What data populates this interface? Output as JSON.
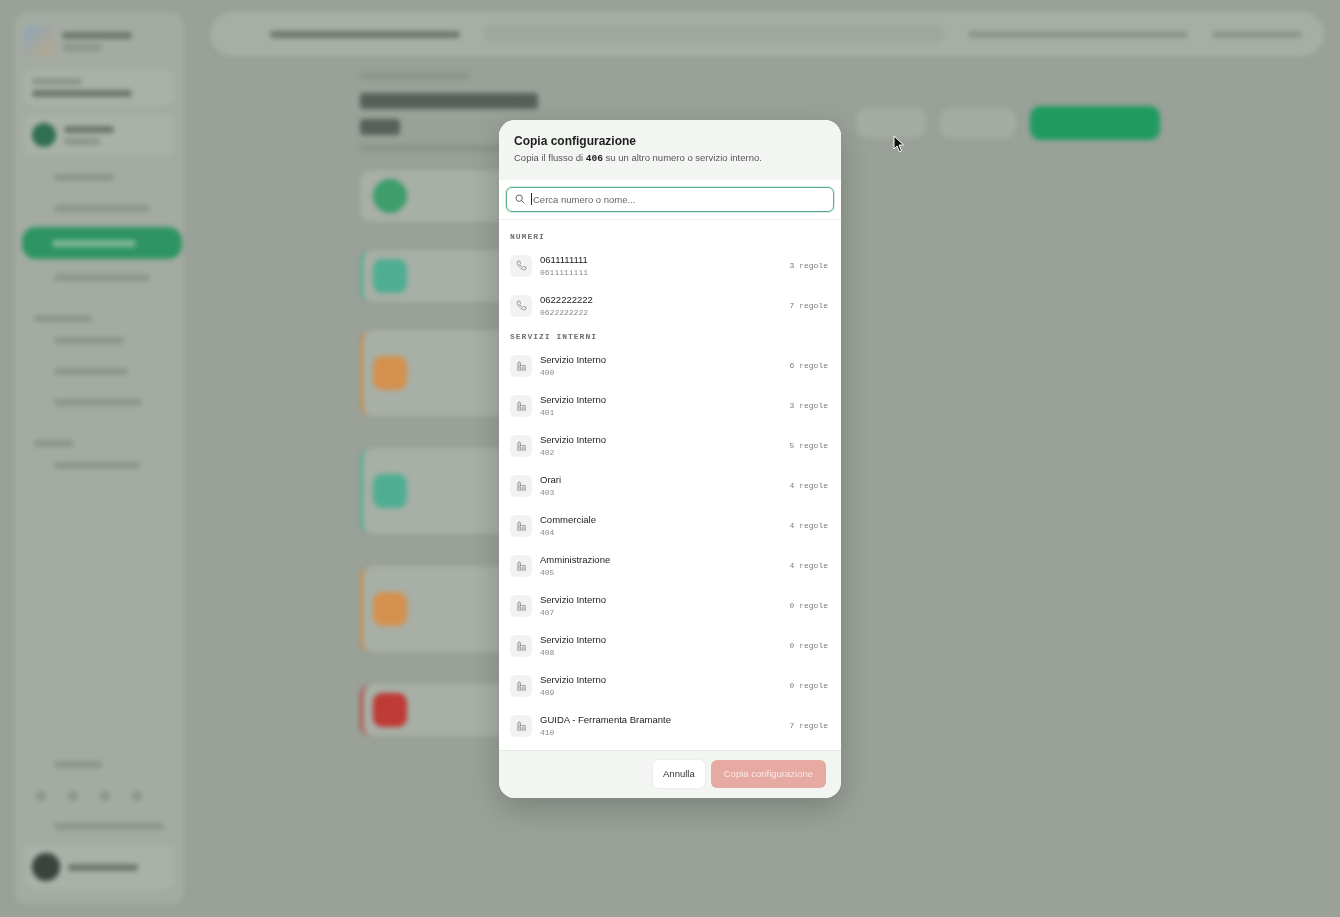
{
  "dialog": {
    "title": "Copia configurazione",
    "subtitle": "Copia il flusso di **406** su un altro numero o servizio interno.",
    "search": {
      "placeholder": "Cerca numero o nome...",
      "focused": true
    },
    "sections": [
      {
        "label": "NUMERI",
        "items": [
          {
            "kind": "phone",
            "name": "0611111111",
            "number": "0611111111",
            "rules": "3 regole"
          },
          {
            "kind": "phone",
            "name": "0622222222",
            "number": "0622222222",
            "rules": "7 regole"
          }
        ]
      },
      {
        "label": "SERVIZI INTERNI",
        "items": [
          {
            "kind": "internal",
            "name": "Servizio Interno",
            "number": "400",
            "rules": "6 regole"
          },
          {
            "kind": "internal",
            "name": "Servizio Interno",
            "number": "401",
            "rules": "3 regole"
          },
          {
            "kind": "internal",
            "name": "Servizio Interno",
            "number": "402",
            "rules": "5 regole"
          },
          {
            "kind": "internal",
            "name": "Orari",
            "number": "403",
            "rules": "4 regole"
          },
          {
            "kind": "internal",
            "name": "Commerciale",
            "number": "404",
            "rules": "4 regole"
          },
          {
            "kind": "internal",
            "name": "Amministrazione",
            "number": "405",
            "rules": "4 regole"
          },
          {
            "kind": "internal",
            "name": "Servizio Interno",
            "number": "407",
            "rules": "0 regole"
          },
          {
            "kind": "internal",
            "name": "Servizio Interno",
            "number": "408",
            "rules": "0 regole"
          },
          {
            "kind": "internal",
            "name": "Servizio Interno",
            "number": "409",
            "rules": "0 regole"
          },
          {
            "kind": "internal",
            "name": "GUIDA - Ferramenta Bramante",
            "number": "410",
            "rules": "7 regole"
          }
        ]
      }
    ],
    "buttons": [
      {
        "label": "Annulla",
        "kind": "secondary",
        "disabled": false
      },
      {
        "label": "Copia configurazione",
        "kind": "primary",
        "disabled": true
      }
    ]
  }
}
